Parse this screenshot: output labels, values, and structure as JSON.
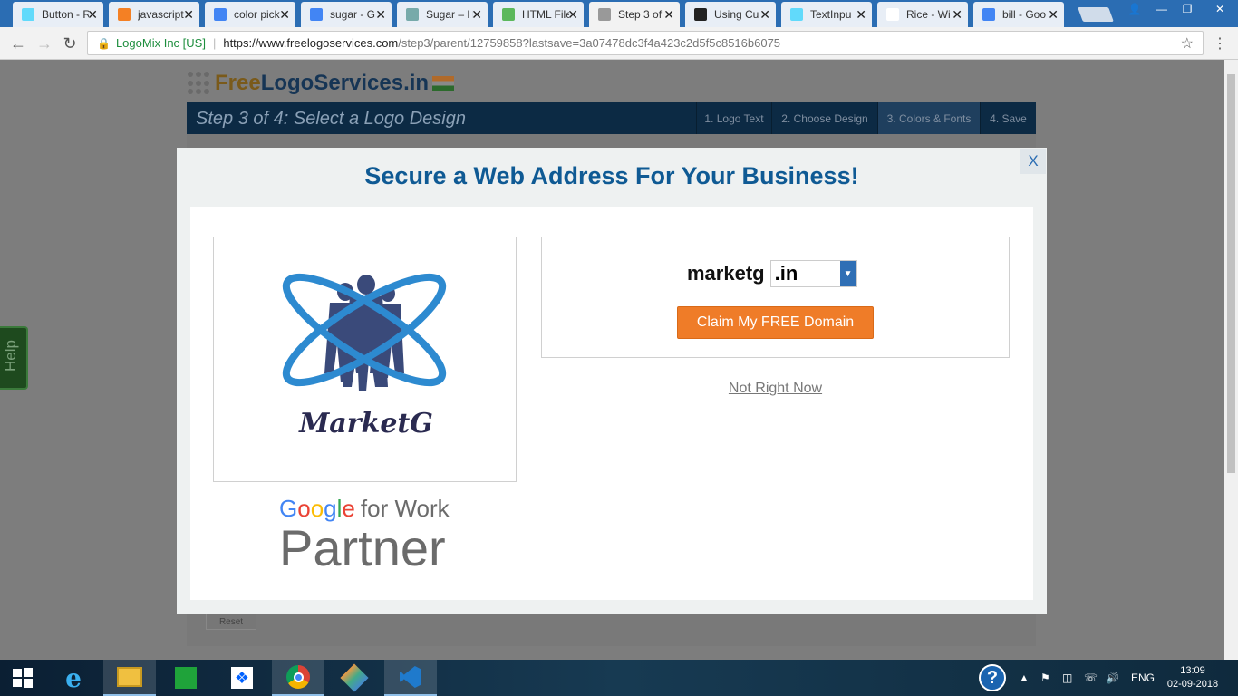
{
  "browser": {
    "tabs": [
      {
        "title": "Button - R",
        "icon": "react-icon",
        "color": "#61dafb"
      },
      {
        "title": "javascript",
        "icon": "stackoverflow-icon",
        "color": "#f48024"
      },
      {
        "title": "color pick",
        "icon": "google-icon",
        "color": "#4285f4"
      },
      {
        "title": "sugar - G",
        "icon": "google-icon",
        "color": "#4285f4"
      },
      {
        "title": "Sugar – H",
        "icon": "sugar-icon",
        "color": "#7aa"
      },
      {
        "title": "HTML File",
        "icon": "html-icon",
        "color": "#5cb85c"
      },
      {
        "title": "Step 3 of",
        "icon": "grid-icon",
        "color": "#999"
      },
      {
        "title": "Using Cu",
        "icon": "angular-icon",
        "color": "#222"
      },
      {
        "title": "TextInpu",
        "icon": "react-icon",
        "color": "#61dafb"
      },
      {
        "title": "Rice - Wi",
        "icon": "wikipedia-icon",
        "color": "#fff"
      },
      {
        "title": "bill - Goo",
        "icon": "google-icon",
        "color": "#4285f4"
      }
    ],
    "active_tab": 6,
    "address": {
      "secure_label": "LogoMix Inc [US]",
      "url_host": "https://www.freelogoservices.com",
      "url_path": "/step3/parent/12759858?lastsave=3a07478dc3f4a423c2d5f5c8516b6075"
    }
  },
  "site": {
    "brand_free": "Free",
    "brand_rest": "LogoServices.in",
    "step_title": "Step 3 of 4: Select a Logo Design",
    "steps": [
      "1. Logo Text",
      "2. Choose Design",
      "3. Colors & Fonts",
      "4. Save"
    ],
    "current_step": 2,
    "reset_label": "Reset",
    "help_label": "Help"
  },
  "modal": {
    "title": "Secure a Web Address For Your Business!",
    "close_label": "X",
    "logo_text": "MarketG",
    "partner": {
      "brand": "Google",
      "suffix": "for Work",
      "label": "Partner"
    },
    "domain": {
      "name": "marketg",
      "tld": ".in"
    },
    "claim_label": "Claim My FREE Domain",
    "decline_label": "Not Right Now"
  },
  "taskbar": {
    "language": "ENG",
    "time": "13:09",
    "date": "02-09-2018"
  },
  "colors": {
    "modal_title": "#0f5a94",
    "claim_button": "#ef7c28",
    "select_arrow": "#2f6fb5"
  }
}
